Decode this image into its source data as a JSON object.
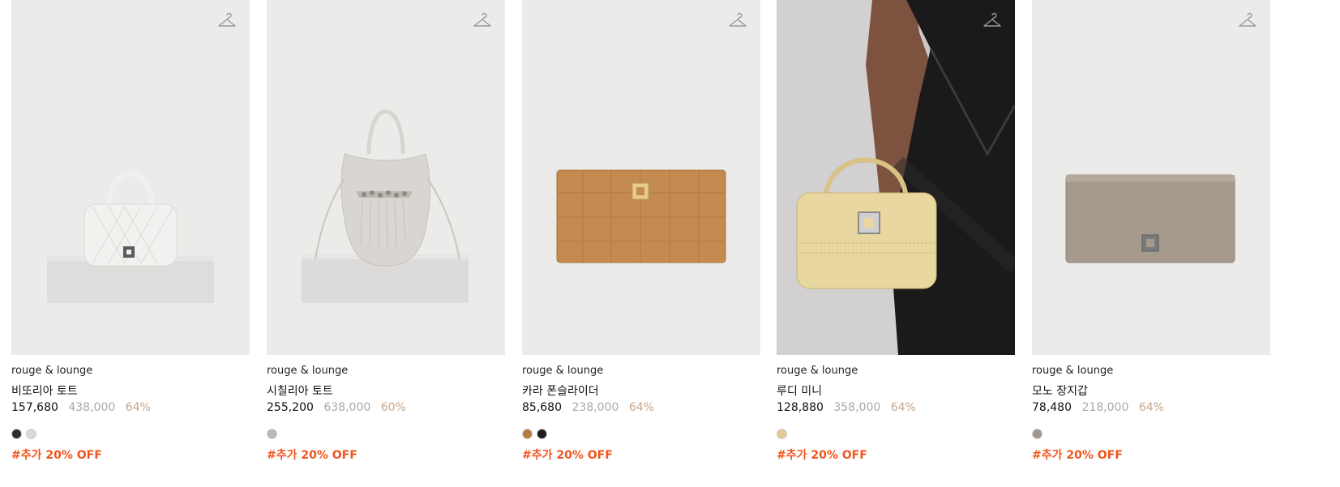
{
  "products": [
    {
      "brand": "rouge & lounge",
      "name": "비또리아 토트",
      "price": "157,680",
      "original_price": "438,000",
      "discount": "64%",
      "swatches": [
        "#2e2e2e",
        "#d8d8d6"
      ],
      "promo": "#추가 20% OFF",
      "image_icon": "white-quilted-tote-bag",
      "wishlist_icon": "hanger-icon"
    },
    {
      "brand": "rouge & lounge",
      "name": "시칠리아 토트",
      "price": "255,200",
      "original_price": "638,000",
      "discount": "60%",
      "swatches": [
        "#bdb7b2"
      ],
      "promo": "#추가 20% OFF",
      "image_icon": "grey-drawstring-tote-bag",
      "wishlist_icon": "hanger-icon"
    },
    {
      "brand": "rouge & lounge",
      "name": "카라 폰슬라이더",
      "price": "85,680",
      "original_price": "238,000",
      "discount": "64%",
      "swatches": [
        "#b57d44",
        "#1c1c1c"
      ],
      "promo": "#추가 20% OFF",
      "image_icon": "camel-croc-wallet",
      "wishlist_icon": "hanger-icon"
    },
    {
      "brand": "rouge & lounge",
      "name": "루디 미니",
      "price": "128,880",
      "original_price": "358,000",
      "discount": "64%",
      "swatches": [
        "#dfcb95"
      ],
      "promo": "#추가 20% OFF",
      "image_icon": "model-holding-beige-mini-bag",
      "wishlist_icon": "hanger-icon"
    },
    {
      "brand": "rouge & lounge",
      "name": "모노 장지갑",
      "price": "78,480",
      "original_price": "218,000",
      "discount": "64%",
      "swatches": [
        "#a3978a"
      ],
      "promo": "#추가 20% OFF",
      "image_icon": "taupe-long-wallet",
      "wishlist_icon": "hanger-icon"
    }
  ]
}
